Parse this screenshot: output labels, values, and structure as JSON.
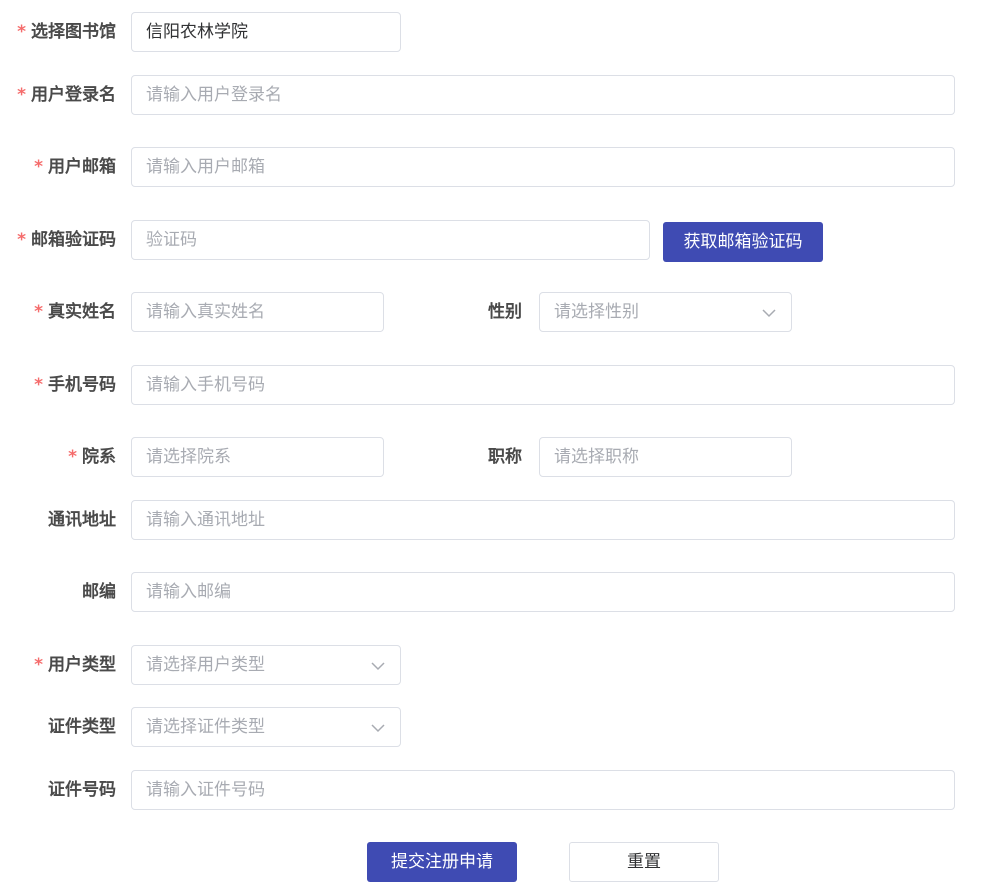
{
  "form": {
    "required_mark": "*",
    "library": {
      "label": "选择图书馆",
      "value": "信阳农林学院"
    },
    "login_name": {
      "label": "用户登录名",
      "placeholder": "请输入用户登录名"
    },
    "email": {
      "label": "用户邮箱",
      "placeholder": "请输入用户邮箱"
    },
    "email_code": {
      "label": "邮箱验证码",
      "placeholder": "验证码",
      "button": "获取邮箱验证码"
    },
    "real_name": {
      "label": "真实姓名",
      "placeholder": "请输入真实姓名"
    },
    "gender": {
      "label": "性别",
      "placeholder": "请选择性别"
    },
    "phone": {
      "label": "手机号码",
      "placeholder": "请输入手机号码"
    },
    "department": {
      "label": "院系",
      "placeholder": "请选择院系"
    },
    "title": {
      "label": "职称",
      "placeholder": "请选择职称"
    },
    "address": {
      "label": "通讯地址",
      "placeholder": "请输入通讯地址"
    },
    "postcode": {
      "label": "邮编",
      "placeholder": "请输入邮编"
    },
    "user_type": {
      "label": "用户类型",
      "placeholder": "请选择用户类型"
    },
    "id_type": {
      "label": "证件类型",
      "placeholder": "请选择证件类型"
    },
    "id_number": {
      "label": "证件号码",
      "placeholder": "请输入证件号码"
    }
  },
  "actions": {
    "submit": "提交注册申请",
    "reset": "重置"
  },
  "icons": {
    "select_arrow": "chevron-down-icon"
  },
  "colors": {
    "primary": "#3f4bb3",
    "required": "#f56c6c",
    "placeholder": "#a8abb2",
    "border": "#dcdfe6"
  }
}
